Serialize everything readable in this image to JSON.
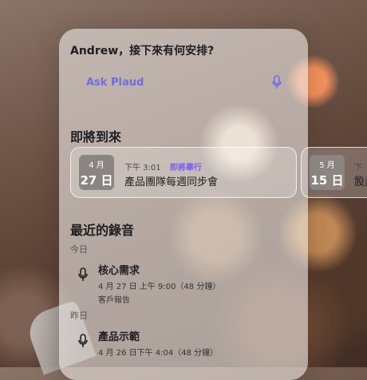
{
  "greeting": "Andrew，接下來有何安排?",
  "ask": {
    "label": "Ask Plaud",
    "icon": "microphone-icon",
    "accent_color": "#6f6ce6"
  },
  "upcoming": {
    "title": "即將到來",
    "events": [
      {
        "month": "4 月",
        "day": "27 日",
        "time": "下午 3:01",
        "status": "即將舉行",
        "title": "產品團隊每週同步會"
      },
      {
        "month": "5 月",
        "day": "15 日",
        "time": "下午",
        "title": "設計"
      }
    ]
  },
  "recordings": {
    "title": "最近的錄音",
    "groups": [
      {
        "label": "今日",
        "items": [
          {
            "title": "核心需求",
            "meta": "4 月 27 日 上午 9:00（48 分鐘）",
            "tag": "客戶報告"
          }
        ]
      },
      {
        "label": "昨日",
        "items": [
          {
            "title": "產品示範",
            "meta": "4 月 26 日下午 4:04（48 分鐘）"
          }
        ]
      }
    ]
  },
  "status_color": "#7a5cf0"
}
